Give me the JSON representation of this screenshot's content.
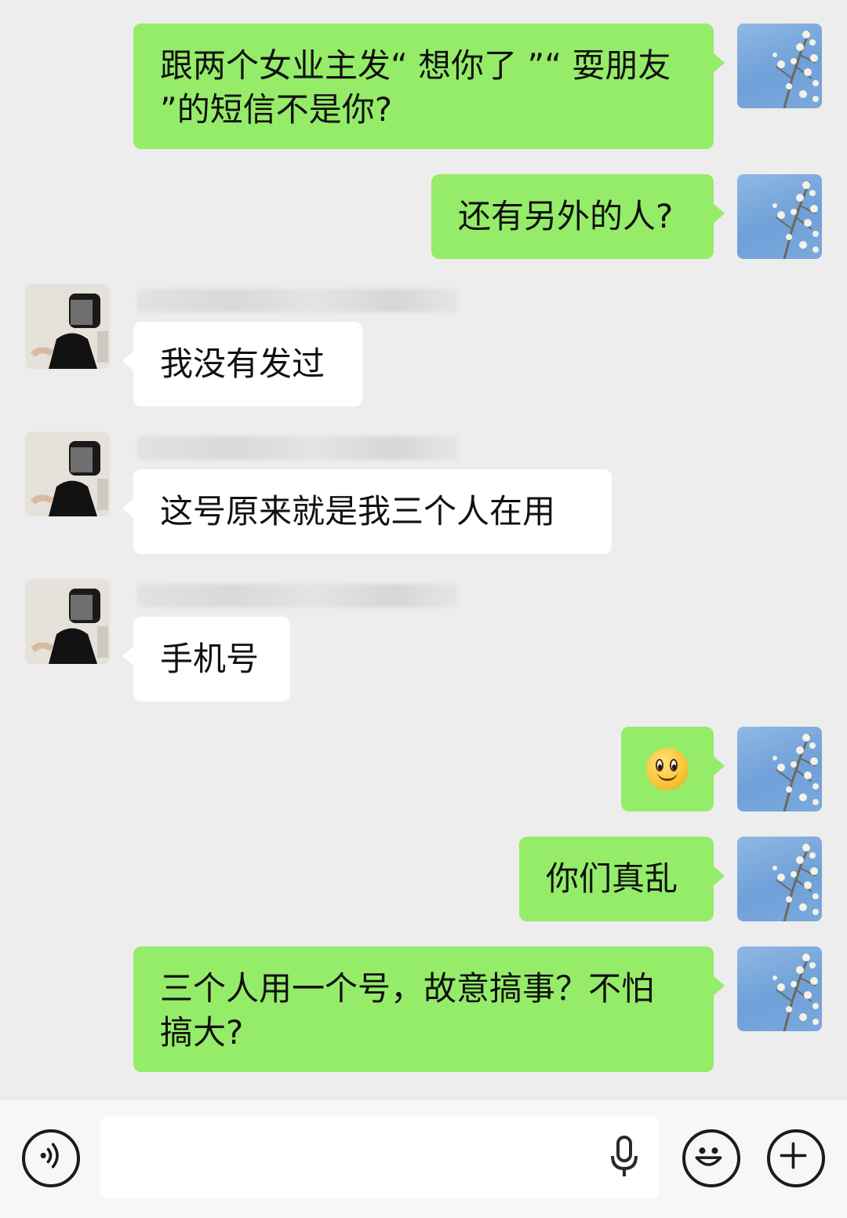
{
  "messages": [
    {
      "id": "m1",
      "from": "me",
      "text_line1": "跟两个女业主发“ 想你了 ”“ 耍朋友",
      "text_line2": "”的短信不是你?"
    },
    {
      "id": "m2",
      "from": "me",
      "text": "还有另外的人?"
    },
    {
      "id": "m3",
      "from": "them",
      "text": "我没有发过"
    },
    {
      "id": "m4",
      "from": "them",
      "text": "这号原来就是我三个人在用"
    },
    {
      "id": "m5",
      "from": "them",
      "text": "手机号"
    },
    {
      "id": "m6",
      "from": "me",
      "emoji": "smile-emoji"
    },
    {
      "id": "m7",
      "from": "me",
      "text": "你们真乱"
    },
    {
      "id": "m8",
      "from": "me",
      "text_line1": "三个人用一个号，故意搞事？不怕",
      "text_line2": "搞大?"
    }
  ],
  "input_bar": {
    "voice_icon": "voice-icon",
    "mic_icon": "microphone-icon",
    "emoji_icon": "emoji-icon",
    "plus_icon": "plus-icon",
    "value": ""
  },
  "colors": {
    "my_bubble": "#95ec69",
    "their_bubble": "#ffffff",
    "background": "#ededed"
  }
}
